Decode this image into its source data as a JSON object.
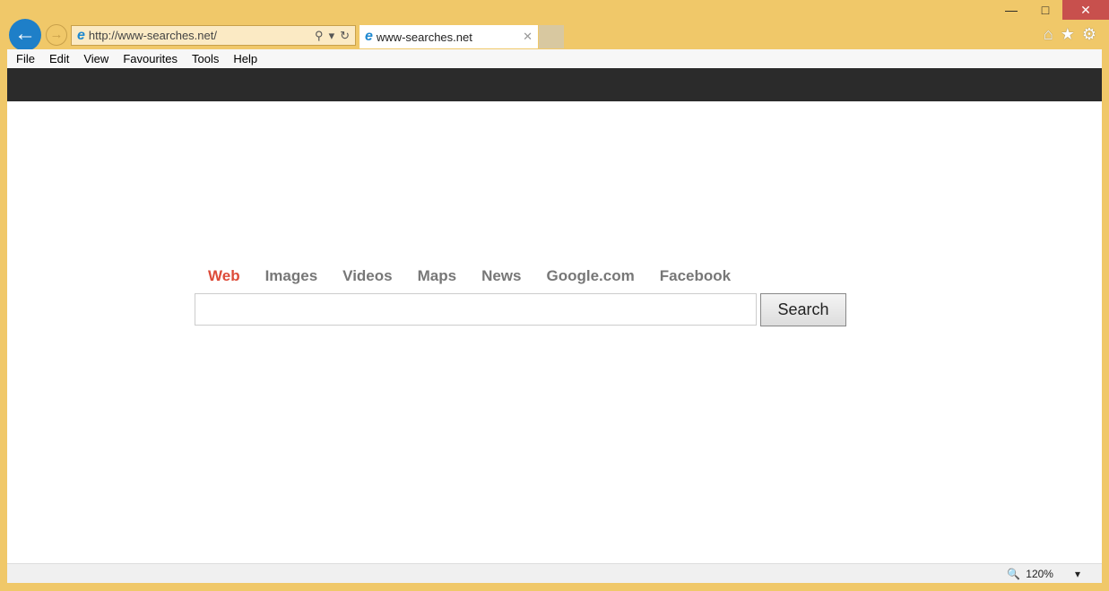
{
  "browser": {
    "url": "http://www-searches.net/",
    "tab_title": "www-searches.net",
    "menu": [
      "File",
      "Edit",
      "View",
      "Favourites",
      "Tools",
      "Help"
    ],
    "zoom": "120%"
  },
  "search": {
    "nav": [
      "Web",
      "Images",
      "Videos",
      "Maps",
      "News",
      "Google.com",
      "Facebook"
    ],
    "query": "",
    "button": "Search"
  }
}
